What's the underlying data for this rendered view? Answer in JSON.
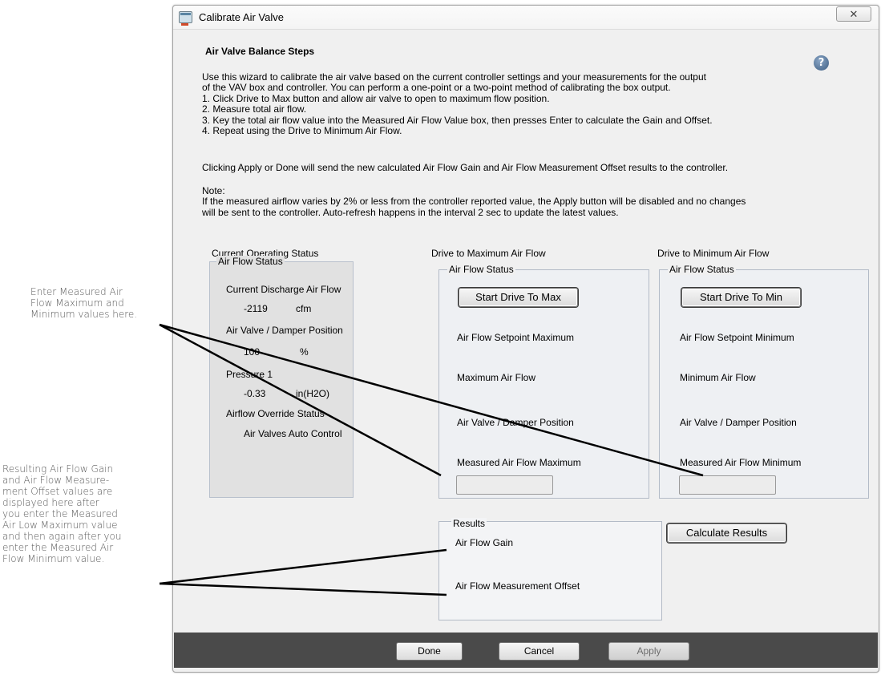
{
  "callouts": {
    "measured": "Enter Measured Air\nFlow Maximum and\nMinimum values here.",
    "results": "Resulting Air Flow Gain\nand Air Flow Measure-\nment Offset values are\ndisplayed here after\nyou enter the Measured\nAir Low Maximum value\nand then again after you\nenter the Measured Air\nFlow Minimum value."
  },
  "window": {
    "title": "Calibrate Air Valve",
    "close_label": "✕"
  },
  "steps": {
    "heading": "Air Valve Balance Steps",
    "help_label": "?",
    "intro_lines": [
      "Use this wizard to calibrate the air valve based on the current controller settings and your measurements for the output",
      "of the VAV box and controller. You can perform a one-point or a two-point method of calibrating the box output.",
      "1. Click Drive to Max button and allow air valve to open to maximum flow position.",
      "2. Measure total air flow.",
      "3. Key the total air flow value into the Measured Air Flow Value box, then presses Enter to calculate the Gain and Offset.",
      "4. Repeat using the Drive to Minimum Air Flow."
    ],
    "clicking": "Clicking Apply or Done will send the new calculated Air Flow Gain and Air Flow Measurement Offset results to the controller.",
    "note_lines": [
      "Note:",
      "If the measured airflow varies by 2% or less from the controller reported value, the Apply button will be disabled and no changes",
      "will be sent to the controller. Auto-refresh happens in the interval 2 sec to update the latest values."
    ]
  },
  "current": {
    "section_title": "Current Operating Status",
    "group_label": "Air Flow Status",
    "discharge_label": "Current Discharge Air Flow",
    "discharge_value": "-2119",
    "discharge_unit": "cfm",
    "damper_label": "Air Valve / Damper Position",
    "damper_value": "100",
    "damper_unit": "%",
    "pressure_label": "Pressure 1",
    "pressure_value": "-0.33",
    "pressure_unit": "in(H2O)",
    "override_label": "Airflow Override Status",
    "override_value": "Air Valves Auto Control"
  },
  "max": {
    "section_title": "Drive to Maximum Air Flow",
    "group_label": "Air Flow Status",
    "button_label": "Start Drive To Max",
    "setpoint_label": "Air Flow Setpoint Maximum",
    "airflow_label": "Maximum Air Flow",
    "damper_label": "Air Valve / Damper Position",
    "measured_label": "Measured Air Flow Maximum",
    "measured_value": ""
  },
  "min": {
    "section_title": "Drive to Minimum Air Flow",
    "group_label": "Air Flow Status",
    "button_label": "Start Drive To Min",
    "setpoint_label": "Air Flow Setpoint Minimum",
    "airflow_label": "Minimum Air Flow",
    "damper_label": "Air Valve / Damper Position",
    "measured_label": "Measured Air Flow Minimum",
    "measured_value": ""
  },
  "results": {
    "group_label": "Results",
    "gain_label": "Air Flow Gain",
    "offset_label": "Air Flow Measurement Offset",
    "calculate_label": "Calculate Results"
  },
  "footer": {
    "done_label": "Done",
    "cancel_label": "Cancel",
    "apply_label": "Apply"
  }
}
